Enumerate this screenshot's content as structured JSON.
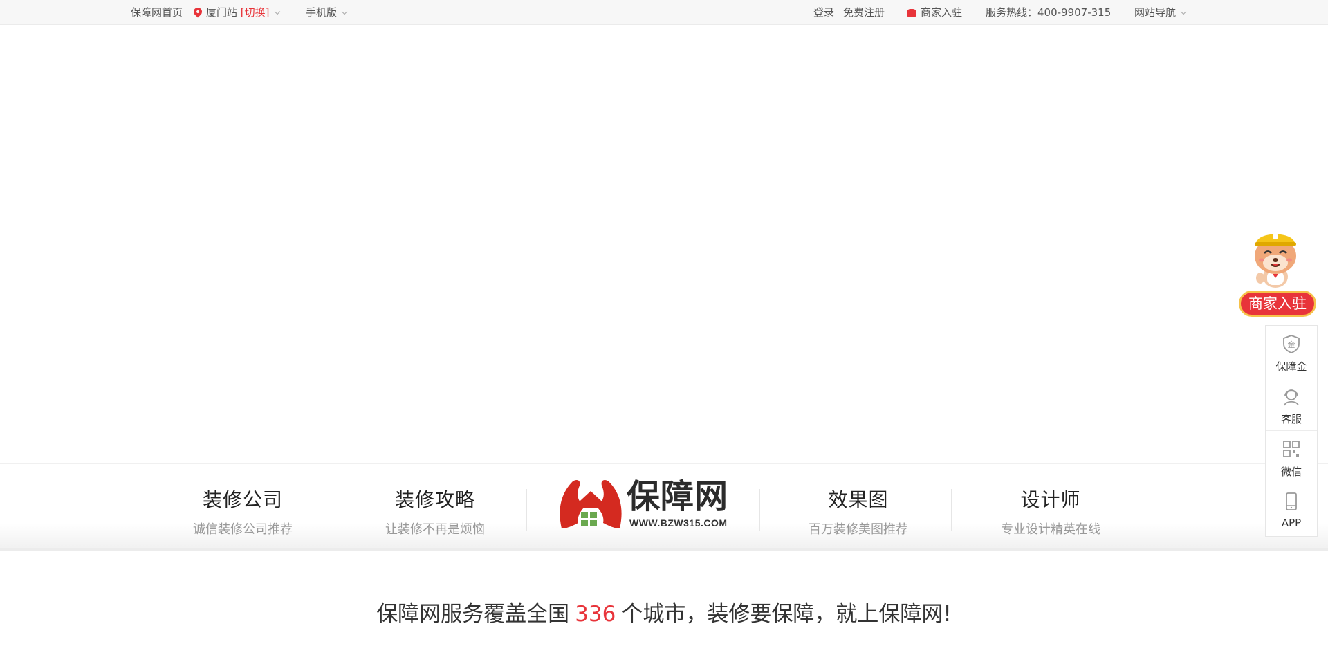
{
  "topbar": {
    "home": "保障网首页",
    "city": "厦门站",
    "switch": "[切换]",
    "mobile": "手机版",
    "login": "登录",
    "register": "免费注册",
    "merchant": "商家入驻",
    "hotline": "服务热线：400-9907-315",
    "sitenav": "网站导航"
  },
  "nav": {
    "items": [
      {
        "title": "装修公司",
        "sub": "诚信装修公司推荐"
      },
      {
        "title": "装修攻略",
        "sub": "让装修不再是烦恼"
      },
      {
        "title": "效果图",
        "sub": "百万装修美图推荐"
      },
      {
        "title": "设计师",
        "sub": "专业设计精英在线"
      }
    ],
    "logo": {
      "name": "保障网",
      "url": "WWW.BZW315.COM"
    }
  },
  "slogan": {
    "before": "保障网服务覆盖全国",
    "count": "336",
    "after": "个城市，装修要保障，就上保障网!"
  },
  "sidebar": {
    "merchant_button": "商家入驻",
    "items": [
      {
        "label": "保障金",
        "icon": "shield-gold-icon"
      },
      {
        "label": "客服",
        "icon": "customer-service-icon"
      },
      {
        "label": "微信",
        "icon": "qr-code-icon"
      },
      {
        "label": "APP",
        "icon": "mobile-phone-icon"
      }
    ]
  },
  "colors": {
    "accent": "#e8343a",
    "logo_hands": "#d42a20",
    "logo_windows": "#6aa84f",
    "merchant_border": "#f6c24a"
  }
}
